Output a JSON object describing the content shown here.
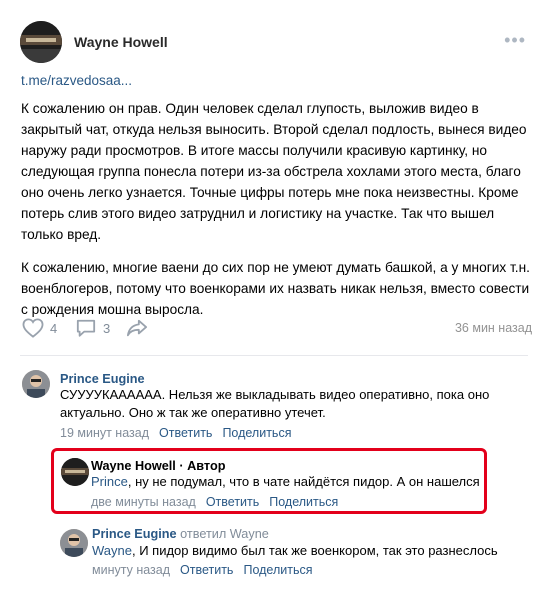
{
  "post": {
    "author": "Wayne Howell",
    "link": "t.me/razvedosaa...",
    "paragraphs": [
      "К сожалению он прав. Один человек сделал глупость, выложив видео в закрытый чат, откуда нельзя выносить. Второй сделал подлость, вынеся видео наружу ради просмотров. В итоге массы получили красивую картинку, но следующая группа понесла потери из-за обстрела хохлами этого места, благо оно очень легко узнается. Точные цифры потерь мне пока неизвестны. Кроме потерь слив этого видео затруднил и логистику на участке. Так что вышел только вред.",
      "К сожалению, многие ваени до сих пор не умеют думать башкой, а у многих т.н. военблогеров, потому что военкорами их назвать никак нельзя, вместо совести с рождения мошна выросла."
    ],
    "likes": "4",
    "comments": "3",
    "time": "36 мин назад",
    "icons": {
      "like": "heart-icon",
      "comment": "comment-icon",
      "share": "share-icon",
      "more": "more-dots-icon"
    }
  },
  "comments": [
    {
      "name": "Prince Eugine",
      "text": "СУУУУКАААААА. Нельзя же выкладывать видео оперативно, пока оно актуально. Оно ж так же оперативно утечет.",
      "time": "19 минут назад",
      "reply": "Ответить",
      "share": "Поделиться"
    },
    {
      "name": "Wayne Howell",
      "author_badge": " · Автор",
      "mention": "Prince",
      "text": ", ну не подумал, что в чате найдётся пидор. А он нашелся",
      "time": "две минуты назад",
      "reply": "Ответить",
      "share": "Поделиться"
    },
    {
      "name": "Prince Eugine",
      "replied": "ответил Wayne",
      "mention": "Wayne",
      "text": ", И пидор видимо был так же военкором, так это разнеслось",
      "time": "минуту назад",
      "reply": "Ответить",
      "share": "Поделиться"
    }
  ],
  "colors": {
    "link": "#2a5885",
    "muted": "#818c99",
    "highlight": "#e3001b"
  }
}
